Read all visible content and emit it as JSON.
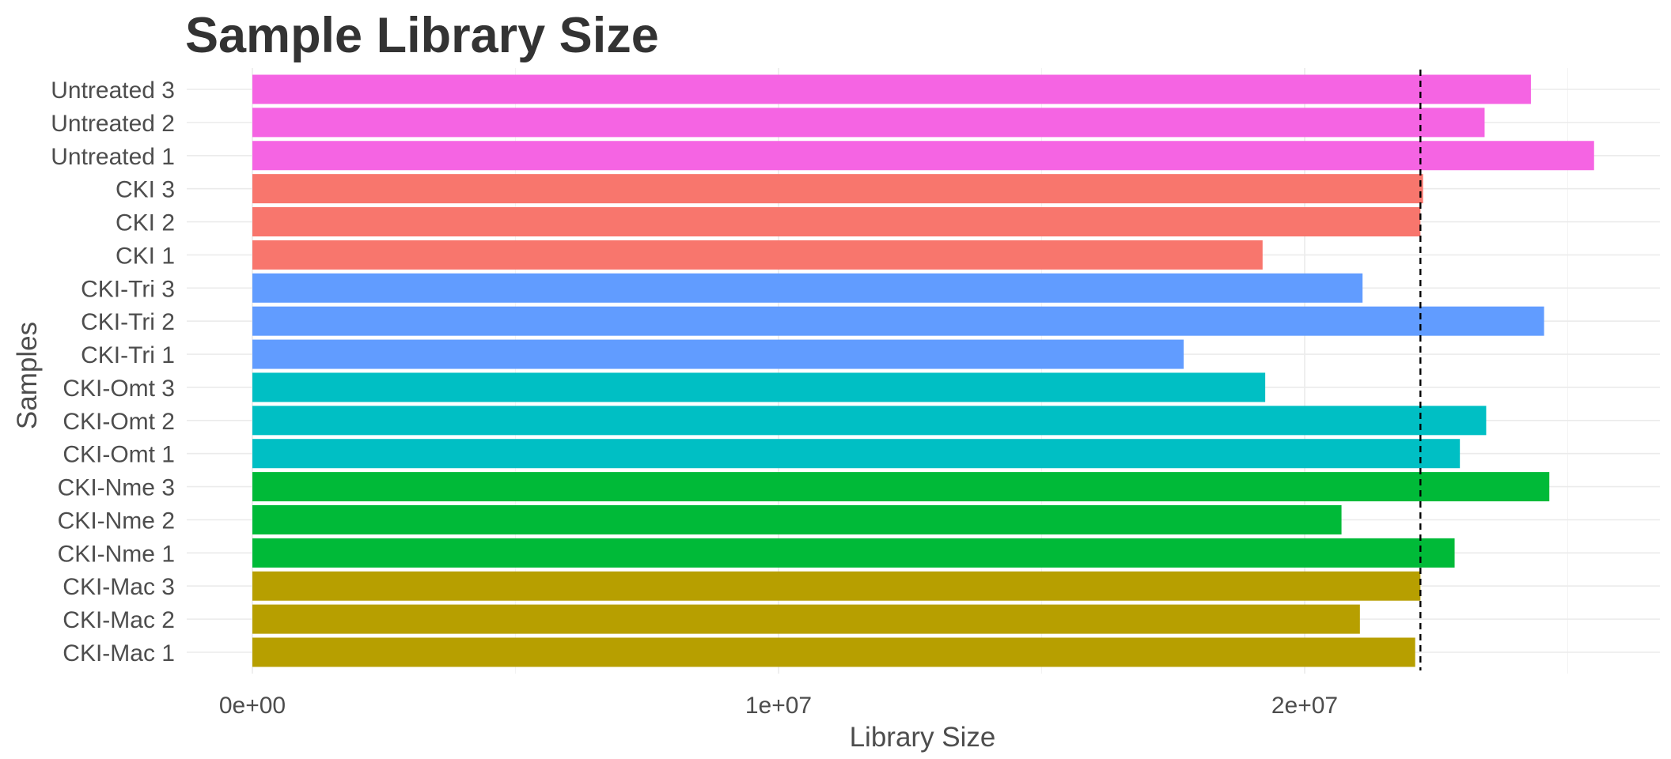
{
  "chart_data": {
    "type": "bar",
    "orientation": "horizontal",
    "title": "Sample Library Size",
    "xlabel": "Library Size",
    "ylabel": "Samples",
    "xlim": [
      0,
      26000000
    ],
    "x_ticks": [
      {
        "value": 0,
        "label": "0e+00"
      },
      {
        "value": 10000000,
        "label": "1e+07"
      },
      {
        "value": 20000000,
        "label": "2e+07"
      }
    ],
    "grid": true,
    "legend": "none",
    "reference_line": {
      "value": 22200000,
      "style": "dashed",
      "color": "#000000"
    },
    "categories": [
      "CKI-Mac 1",
      "CKI-Mac 2",
      "CKI-Mac 3",
      "CKI-Nme 1",
      "CKI-Nme 2",
      "CKI-Nme 3",
      "CKI-Omt 1",
      "CKI-Omt 2",
      "CKI-Omt 3",
      "CKI-Tri 1",
      "CKI-Tri 2",
      "CKI-Tri 3",
      "CKI 1",
      "CKI 2",
      "CKI 3",
      "Untreated 1",
      "Untreated 2",
      "Untreated 3"
    ],
    "values": [
      22100000,
      21050000,
      22200000,
      22850000,
      20700000,
      24650000,
      22950000,
      23450000,
      19250000,
      17700000,
      24550000,
      21100000,
      19200000,
      22200000,
      22250000,
      25500000,
      23420000,
      24300000
    ],
    "groups": [
      "CKI-Mac",
      "CKI-Mac",
      "CKI-Mac",
      "CKI-Nme",
      "CKI-Nme",
      "CKI-Nme",
      "CKI-Omt",
      "CKI-Omt",
      "CKI-Omt",
      "CKI-Tri",
      "CKI-Tri",
      "CKI-Tri",
      "CKI",
      "CKI",
      "CKI",
      "Untreated",
      "Untreated",
      "Untreated"
    ],
    "group_colors": {
      "CKI-Mac": "#b79f00",
      "CKI-Nme": "#00ba38",
      "CKI-Omt": "#00bfc4",
      "CKI-Tri": "#619cff",
      "CKI": "#f8766d",
      "Untreated": "#f564e3"
    }
  }
}
